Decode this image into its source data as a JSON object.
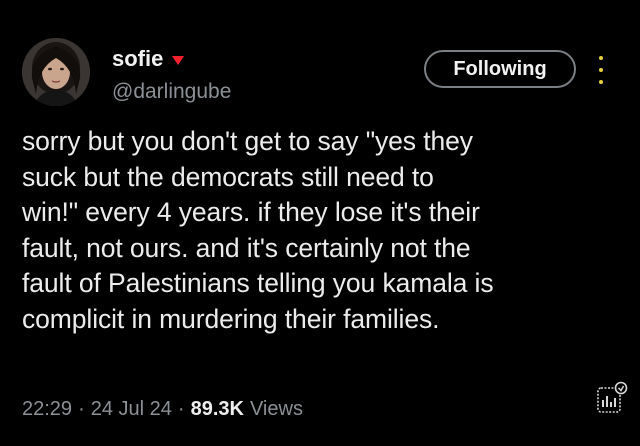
{
  "user": {
    "display_name": "sofie",
    "handle": "@darlingube",
    "badge_icon": "heart-icon",
    "badge_color": "#f4212e"
  },
  "actions": {
    "follow_label": "Following",
    "more_icon": "more-vertical-icon"
  },
  "tweet": {
    "lines": [
      "sorry but you don't get to say \"yes they",
      "suck but the democrats still need to",
      "win!\" every 4 years. if they lose it's their",
      "fault, not ours. and it's certainly not the",
      "fault of Palestinians telling you kamala is",
      "complicit in murdering their families."
    ]
  },
  "meta": {
    "time": "22:29",
    "separator": "·",
    "date": "24 Jul 24",
    "views_count": "89.3K",
    "views_label": "Views",
    "analytics_icon": "analytics-icon"
  }
}
